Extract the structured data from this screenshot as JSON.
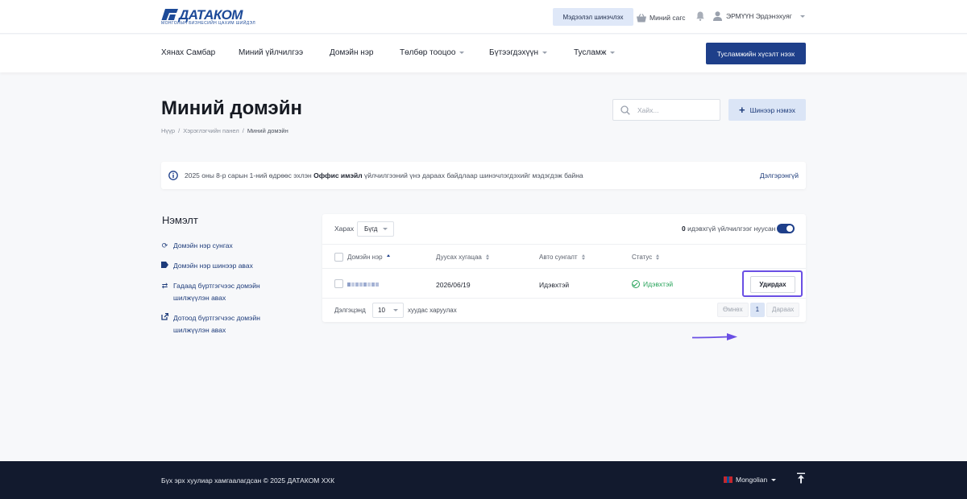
{
  "brand": {
    "name": "ДАТАКОМ",
    "tagline": "МОНГОЛЫН БИЗНЕСИЙН ЦАХИМ ШИЙДЭЛ",
    "color": "#1d4a98"
  },
  "topbar": {
    "notify_button": "Мэдээлэл шинэчлэх",
    "cart_label": "Миний сагс",
    "cart_icon": "basket-icon",
    "bell_icon": "bell-icon",
    "user_name": "ЭРМҮҮН Эрдэнэхуяг",
    "user_icon": "user-icon"
  },
  "nav": {
    "items": [
      "Хянах Самбар",
      "Миний үйлчилгээ",
      "Домэйн нэр",
      "Төлбөр тооцоо",
      "Бүтээгдэхүүн",
      "Тусламж"
    ],
    "support_button": "Тусламжийн хүсэлт нээх"
  },
  "page": {
    "title": "Миний домэйн",
    "breadcrumb": [
      "Нүүр",
      "Хэрэглэгчийн панел",
      "Миний домэйн"
    ],
    "breadcrumb_sep": "/",
    "search_placeholder": "Хайх...",
    "add_button": "Шинээр нэмэх"
  },
  "alert": {
    "pre": "2025 оны 8-р сарын 1-ний өдрөөс эхлэн ",
    "bold": "Оффис имэйл",
    "post": " үйлчилгээний үнэ дараах байдлаар шинэчлэгдэхийг мэдэгдэж байна",
    "link": "Дэлгэрэнгүй",
    "icon": "info-icon"
  },
  "sidebar": {
    "title": "Нэмэлт",
    "items": [
      {
        "label": "Домэйн нэр сунгах",
        "icon": "renew-icon"
      },
      {
        "label": "Домэйн нэр шинээр авах",
        "icon": "tag-icon"
      },
      {
        "label": "Гадаад бүртгэгчээс домэйн шилжүүлэн авах",
        "icon": "transfer-icon"
      },
      {
        "label": "Дотоод бүртгэгчээс домэйн шилжүүлэн авах",
        "icon": "external-link-icon"
      }
    ]
  },
  "table": {
    "view_label": "Харах",
    "view_value": "Бүгд",
    "hidden_count": "0",
    "hidden_text": " идэвхгүй үйлчилгээг нуусан",
    "columns": [
      "Домэйн нэр",
      "Дуусах хугацаа",
      "Авто сунгалт",
      "Статус"
    ],
    "rows": [
      {
        "expiry": "2026/06/19",
        "auto_renew": "Идэвхтэй",
        "status": "Идэвхтэй",
        "action": "Удирдах"
      }
    ],
    "footer_show": "Дэлгэцэнд",
    "per_page": "10",
    "footer_suffix": "хуудас харуулах",
    "pager": {
      "prev": "Өмнөх",
      "current": "1",
      "next": "Дараах"
    },
    "status_color": "#27a35a",
    "highlight_color": "#6a4fe4"
  },
  "footer": {
    "copyright": "Бүх эрх хуулиар хамгаалагдсан © 2025 ДАТАКОМ ХХК",
    "language": "Mongolian",
    "to_top_icon": "arrow-up-icon"
  }
}
